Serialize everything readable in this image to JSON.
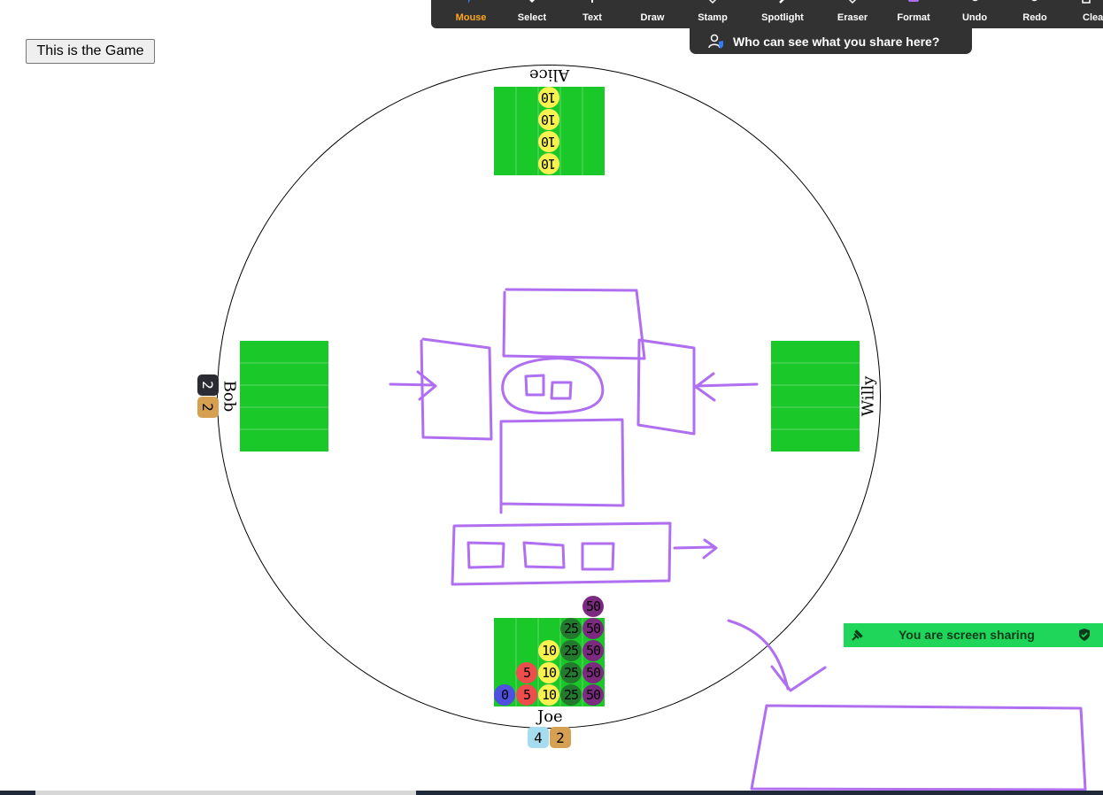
{
  "game_button": {
    "label": "This is the Game"
  },
  "players": {
    "alice": {
      "name": "Alice",
      "chips": [
        "10",
        "10",
        "10",
        "10"
      ]
    },
    "bob": {
      "name": "Bob",
      "badges": [
        "2",
        "2"
      ]
    },
    "willy": {
      "name": "Willy"
    },
    "joe": {
      "name": "Joe",
      "badges": [
        "4",
        "2"
      ],
      "chips": {
        "col0": [
          "0"
        ],
        "col1": [
          "5",
          "5"
        ],
        "col2": [
          "10",
          "10",
          "10"
        ],
        "col3": [
          "25",
          "25",
          "25",
          "25"
        ],
        "col4": [
          "50",
          "50",
          "50",
          "50",
          "50"
        ]
      }
    }
  },
  "colors": {
    "board": "#1ac82a",
    "chip_0": "#4f4fe0",
    "chip_5": "#ef4c4c",
    "chip_10": "#f8f251",
    "chip_25": "#237a2e",
    "chip_50": "#7c2a7f",
    "badge_dark": "#2b2b33",
    "badge_gold": "#d6a052",
    "badge_blue": "#a5dcef",
    "annotation": "#b06ef0",
    "toolbar_bg": "#323232",
    "toolbar_active": "#ffa51f",
    "share_green": "#1fd65a"
  },
  "toolbar": {
    "items": [
      {
        "label": "Mouse",
        "icon": "cursor-icon",
        "active": true
      },
      {
        "label": "Select",
        "icon": "select-icon"
      },
      {
        "label": "Text",
        "icon": "text-icon"
      },
      {
        "label": "Draw",
        "icon": "draw-icon"
      },
      {
        "label": "Stamp",
        "icon": "stamp-icon"
      },
      {
        "label": "Spotlight",
        "icon": "spotlight-icon"
      },
      {
        "label": "Eraser",
        "icon": "eraser-icon"
      },
      {
        "label": "Format",
        "icon": "format-icon"
      },
      {
        "label": "Undo",
        "icon": "undo-icon"
      },
      {
        "label": "Redo",
        "icon": "redo-icon"
      },
      {
        "label": "Clea",
        "icon": "trash-icon"
      }
    ]
  },
  "share_notice": {
    "text": "Who can see what you share here?",
    "icon": "people-shield-icon"
  },
  "screen_sharing": {
    "text": "You are screen sharing",
    "icons": [
      "pin-icon",
      "shield-check-icon"
    ]
  }
}
